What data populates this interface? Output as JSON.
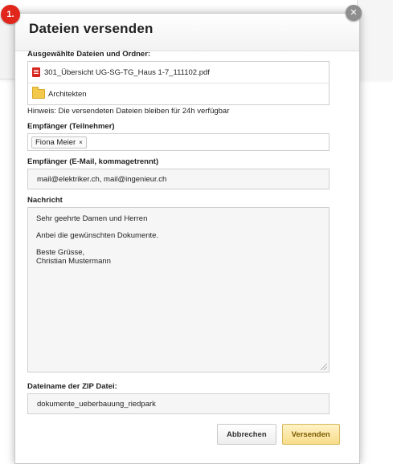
{
  "dialog": {
    "step": "1.",
    "title": "Dateien versenden",
    "close": "×"
  },
  "files": {
    "label": "Ausgewählte Dateien und Ordner:",
    "items": [
      {
        "name": "301_Übersicht UG-SG-TG_Haus 1-7_111102.pdf",
        "icon": "pdf-icon"
      },
      {
        "name": "Architekten",
        "icon": "folder-icon"
      }
    ],
    "hint": "Hinweis: Die versendeten Dateien bleiben für 24h verfügbar"
  },
  "recipients": {
    "label": "Empfänger (Teilnehmer)",
    "tags": [
      {
        "name": "Fiona Meier",
        "remove": "×"
      }
    ]
  },
  "emails": {
    "label": "Empfänger (E-Mail, kommagetrennt)",
    "value": "mail@elektriker.ch, mail@ingenieur.ch"
  },
  "message": {
    "label": "Nachricht",
    "paragraphs": [
      "Sehr geehrte Damen und Herren",
      "Anbei die gewünschten Dokumente.",
      "Beste Grüsse,\nChristian Mustermann"
    ]
  },
  "zip": {
    "label": "Dateiname der ZIP Datei:",
    "value": "dokumente_ueberbauung_riedpark"
  },
  "actions": {
    "cancel": "Abbrechen",
    "send": "Versenden"
  },
  "colors": {
    "badge": "#e1271b",
    "send_button": "#f7dc8a"
  }
}
